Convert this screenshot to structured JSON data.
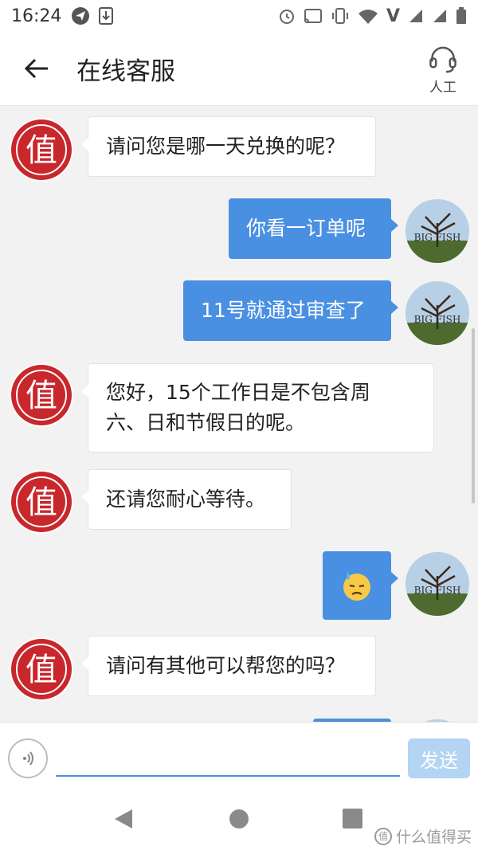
{
  "status_bar": {
    "time": "16:24",
    "left_icons": [
      "send-icon",
      "download-icon"
    ],
    "right_icons": [
      "alarm-icon",
      "cast-icon",
      "vibrate-icon",
      "wifi-icon",
      "volte-icon",
      "signal-icon",
      "signal-icon",
      "battery-icon"
    ],
    "volte_label": "V"
  },
  "header": {
    "title": "在线客服",
    "human_label": "人工"
  },
  "messages": [
    {
      "side": "in",
      "sender": "agent",
      "text": "请问您是哪一天兑换的呢？"
    },
    {
      "side": "out",
      "sender": "user",
      "text": "你看一订单呢"
    },
    {
      "side": "out",
      "sender": "user",
      "text": "11号就通过审查了"
    },
    {
      "side": "in",
      "sender": "agent",
      "text": "您好，15个工作日是不包含周\n六、日和节假日的呢。"
    },
    {
      "side": "in",
      "sender": "agent",
      "text": "还请您耐心等待。"
    },
    {
      "side": "out",
      "sender": "user",
      "text": "",
      "emoji": "😓"
    },
    {
      "side": "in",
      "sender": "agent",
      "text": "请问有其他可以帮您的吗？"
    }
  ],
  "avatars": {
    "agent": "值",
    "user": "BIG FISH"
  },
  "input": {
    "value": "",
    "placeholder": "",
    "send_label": "发送"
  },
  "nav": {
    "watermark": "什么值得买",
    "watermark_badge": "值"
  },
  "colors": {
    "accent": "#4a90e2",
    "send_disabled": "#b3d4f3",
    "agent_red": "#c8272c"
  }
}
